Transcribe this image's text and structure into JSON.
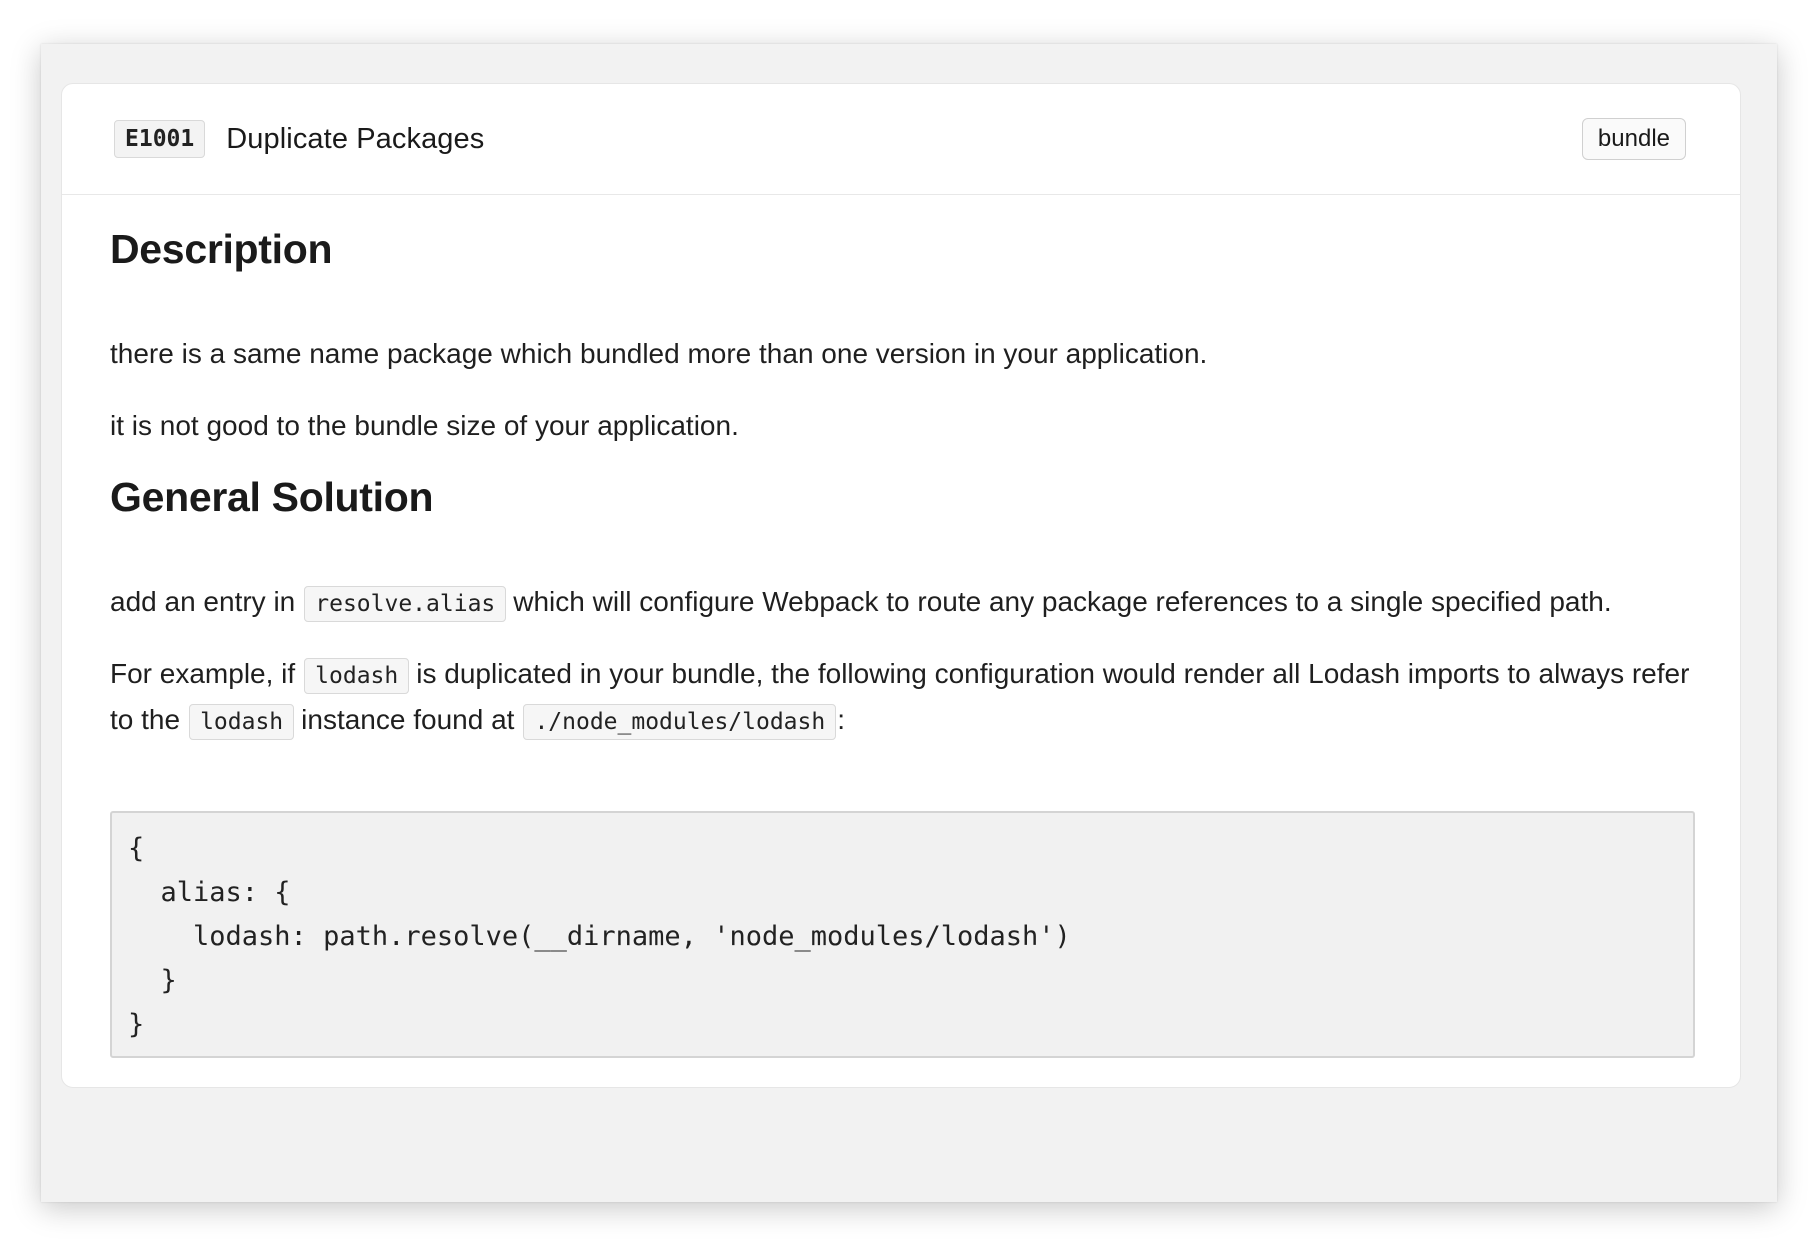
{
  "header": {
    "code": "E1001",
    "title": "Duplicate Packages",
    "tag": "bundle"
  },
  "description": {
    "heading": "Description",
    "paragraphs": [
      "there is a same name package which bundled more than one version in your application.",
      "it is not good to the bundle size of your application."
    ]
  },
  "solution": {
    "heading": "General Solution",
    "p1": {
      "before": "add an entry in",
      "code": "resolve.alias",
      "after": "which will configure Webpack to route any package references to a single specified path."
    },
    "p2": {
      "t1": "For example, if",
      "c1": "lodash",
      "t2": "is duplicated in your bundle, the following configuration would render all Lodash imports to always refer to the",
      "c2": "lodash",
      "t3": "instance found at",
      "c3": "./node_modules/lodash",
      "t4": ":"
    },
    "code_lines": [
      "{",
      "  alias: {",
      "    lodash: path.resolve(__dirname, 'node_modules/lodash')",
      "  }",
      "}"
    ]
  }
}
